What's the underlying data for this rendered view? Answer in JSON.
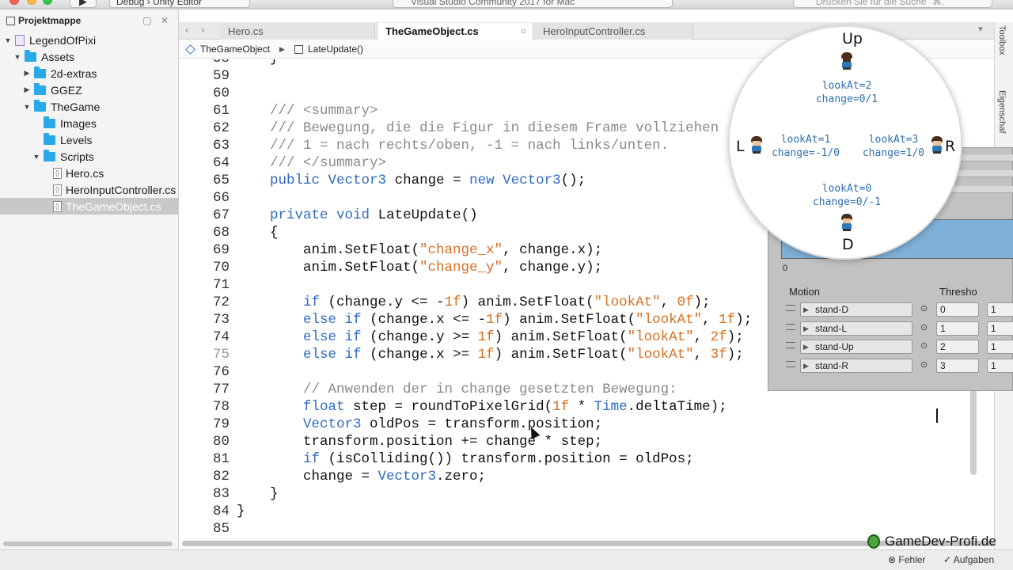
{
  "toolbar": {
    "run_icon": "play-icon",
    "configuration": "Debug",
    "breadcrumb_sep": "›",
    "target": "Unity Editor",
    "status": "Visual Studio Community 2017 for Mac",
    "search_placeholder": "Drücken Sie für die Suche \"⌘.\""
  },
  "sidebar": {
    "title": "Projektmappe",
    "controls": "▢ ✕",
    "tree": [
      {
        "label": "LegendOfPixi",
        "indent": 0,
        "arrow": "▼",
        "icon": "solution"
      },
      {
        "label": "Assets",
        "indent": 1,
        "arrow": "▼",
        "icon": "folder"
      },
      {
        "label": "2d-extras",
        "indent": 2,
        "arrow": "▶",
        "icon": "folder"
      },
      {
        "label": "GGEZ",
        "indent": 2,
        "arrow": "▶",
        "icon": "folder"
      },
      {
        "label": "TheGame",
        "indent": 2,
        "arrow": "▼",
        "icon": "folder"
      },
      {
        "label": "Images",
        "indent": 3,
        "arrow": "",
        "icon": "folder"
      },
      {
        "label": "Levels",
        "indent": 3,
        "arrow": "",
        "icon": "folder"
      },
      {
        "label": "Scripts",
        "indent": 3,
        "arrow": "▼",
        "icon": "folder"
      },
      {
        "label": "Hero.cs",
        "indent": 4,
        "arrow": "",
        "icon": "file"
      },
      {
        "label": "HeroInputController.cs",
        "indent": 4,
        "arrow": "",
        "icon": "file"
      },
      {
        "label": "TheGameObject.cs",
        "indent": 4,
        "arrow": "",
        "icon": "file",
        "selected": true
      }
    ]
  },
  "tabs": [
    {
      "label": "Hero.cs"
    },
    {
      "label": "TheGameObject.cs",
      "active": true,
      "close": "○"
    },
    {
      "label": "HeroInputController.cs"
    }
  ],
  "breadcrumb": {
    "class_name": "TheGameObject",
    "sep": "▶",
    "method_name": "LateUpdate()"
  },
  "editor": {
    "current_line": "75",
    "lines": [
      {
        "n": "58",
        "code": "    }"
      },
      {
        "n": "59",
        "code": ""
      },
      {
        "n": "60",
        "code": ""
      },
      {
        "n": "61",
        "code": "    /// <summary>"
      },
      {
        "n": "62",
        "code": "    /// Bewegung, die die Figur in diesem Frame vollziehen"
      },
      {
        "n": "63",
        "code": "    /// 1 = nach rechts/oben, -1 = nach links/unten."
      },
      {
        "n": "64",
        "code": "    /// </summary>"
      },
      {
        "n": "65",
        "code": "    public Vector3 change = new Vector3();"
      },
      {
        "n": "66",
        "code": ""
      },
      {
        "n": "67",
        "code": "    private void LateUpdate()"
      },
      {
        "n": "68",
        "code": "    {"
      },
      {
        "n": "69",
        "code": "        anim.SetFloat(\"change_x\", change.x);"
      },
      {
        "n": "70",
        "code": "        anim.SetFloat(\"change_y\", change.y);"
      },
      {
        "n": "71",
        "code": ""
      },
      {
        "n": "72",
        "code": "        if (change.y <= -1f) anim.SetFloat(\"lookAt\", 0f);"
      },
      {
        "n": "73",
        "code": "        else if (change.x <= -1f) anim.SetFloat(\"lookAt\", 1f);"
      },
      {
        "n": "74",
        "code": "        else if (change.y >= 1f) anim.SetFloat(\"lookAt\", 2f);"
      },
      {
        "n": "75",
        "code": "        else if (change.x >= 1f) anim.SetFloat(\"lookAt\", 3f);"
      },
      {
        "n": "76",
        "code": ""
      },
      {
        "n": "77",
        "code": "        // Anwenden der in change gesetzten Bewegung:"
      },
      {
        "n": "78",
        "code": "        float step = roundToPixelGrid(1f * Time.deltaTime);"
      },
      {
        "n": "79",
        "code": "        Vector3 oldPos = transform.position;"
      },
      {
        "n": "80",
        "code": "        transform.position += change * step;"
      },
      {
        "n": "81",
        "code": "        if (isColliding()) transform.position = oldPos;"
      },
      {
        "n": "82",
        "code": "        change = Vector3.zero;"
      },
      {
        "n": "83",
        "code": "    }"
      },
      {
        "n": "84",
        "code": "}"
      },
      {
        "n": "85",
        "code": ""
      }
    ]
  },
  "right_strip": {
    "toolbox": "Toolbox",
    "properties": "Eigenschaf"
  },
  "unity_panel": {
    "zero_label": "0",
    "col_motion": "Motion",
    "col_threshold": "Thresho",
    "rows": [
      {
        "motion": "stand-D",
        "threshold": "0",
        "speed": "1"
      },
      {
        "motion": "stand-L",
        "threshold": "1",
        "speed": "1"
      },
      {
        "motion": "stand-Up",
        "threshold": "2",
        "speed": "1"
      },
      {
        "motion": "stand-R",
        "threshold": "3",
        "speed": "1"
      }
    ]
  },
  "magnifier": {
    "up_letter": "Up",
    "down_letter": "D",
    "left_letter": "L",
    "right_letter": "R",
    "up_note_1": "lookAt=2",
    "up_note_2": "change=0/1",
    "left_note_1": "lookAt=1",
    "left_note_2": "change=-1/0",
    "right_note_1": "lookAt=3",
    "right_note_2": "change=1/0",
    "down_note_1": "lookAt=0",
    "down_note_2": "change=0/-1"
  },
  "statusbar": {
    "errors": "Fehler",
    "tasks": "Aufgaben"
  },
  "watermark": "GameDev-Profi.de",
  "colors": {
    "keyword": "#2e6bc0",
    "string": "#d7701f",
    "comment": "#8a8a8a",
    "folder": "#2aa9e8",
    "selection": "#c8c8c8"
  }
}
